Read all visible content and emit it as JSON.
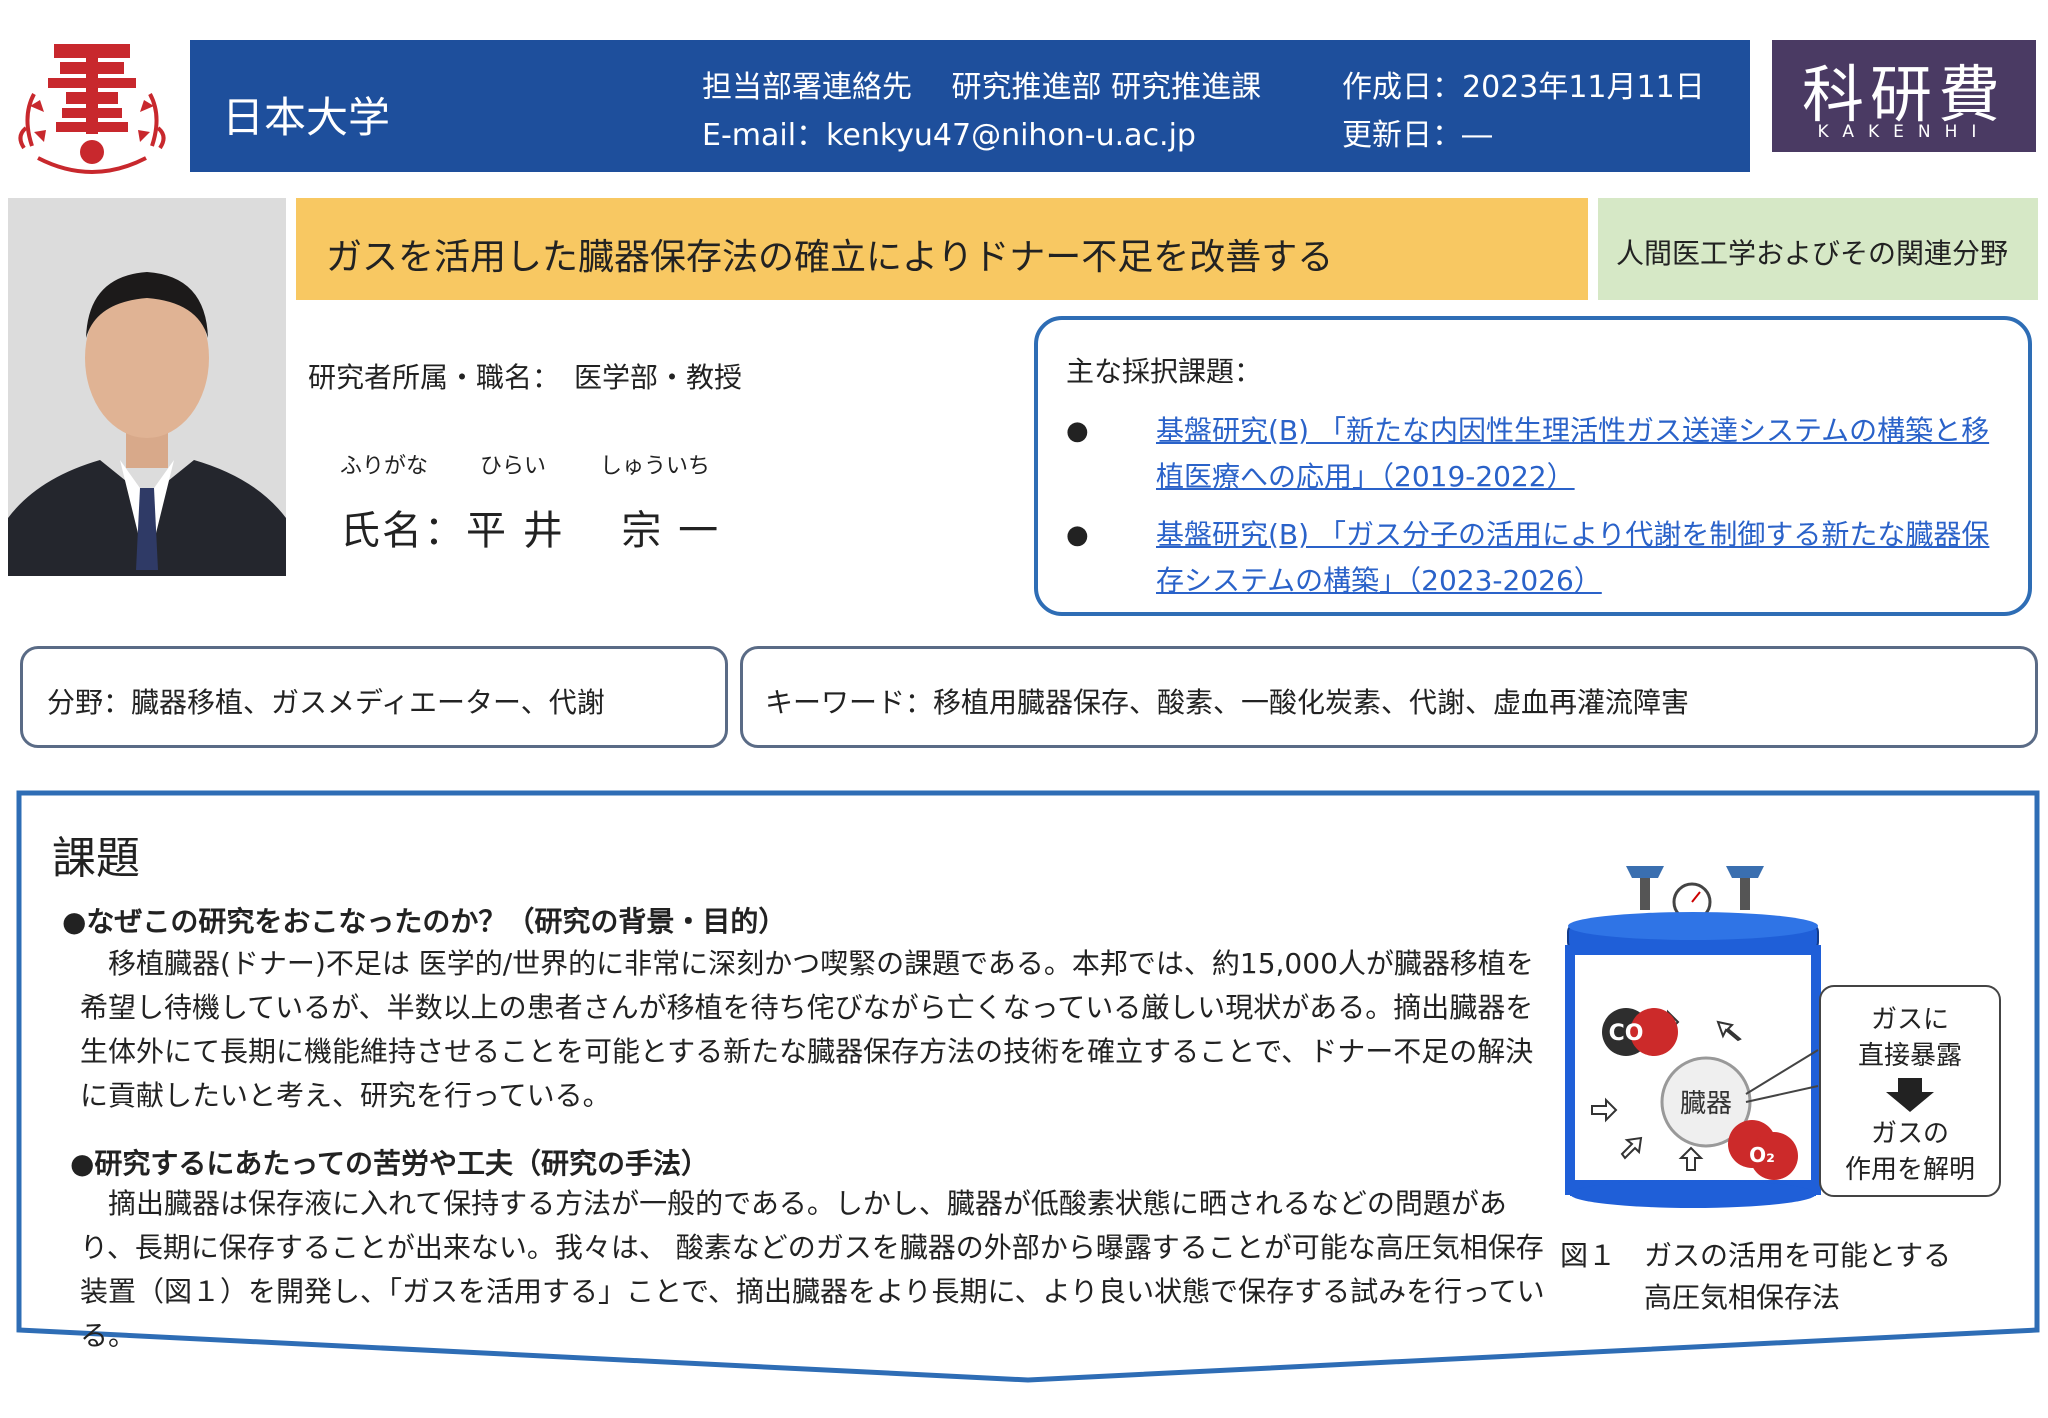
{
  "header": {
    "university": "日本大学",
    "contact_dept": "担当部署連絡先　 研究推進部 研究推進課",
    "contact_email": "E-mail：kenkyu47@nihon-u.ac.jp",
    "created": "作成日：2023年11月11日",
    "updated": "更新日：―",
    "kakenhi_main": "科研費",
    "kakenhi_sub": "KAKENHI"
  },
  "title": "ガスを活用した臓器保存法の確立によりドナー不足を改善する",
  "field": "人間医工学およびその関連分野",
  "researcher": {
    "affiliation": "研究者所属・職名：　医学部・教授",
    "furigana_label": "ふりがな",
    "furigana_last": "ひらい",
    "furigana_first": "しゅういち",
    "name": "氏名：平 井　 宗 一"
  },
  "grants": {
    "heading": "主な採択課題：",
    "bullet": "●",
    "items": [
      "基盤研究(B) 「新たな内因性生理活性ガス送達システムの構築と移植医療への応用」（2019-2022）",
      "基盤研究(B) 「ガス分子の活用により代謝を制御する新たな臓器保存システムの構築」（2023-2026）"
    ]
  },
  "bunya": "分野：臓器移植、ガスメディエーター、代謝",
  "keywords": "キーワード：移植用臓器保存、酸素、一酸化炭素、代謝、虚血再灌流障害",
  "kadai": {
    "title": "課題",
    "q1": "●なぜこの研究をおこなったのか？（研究の背景・目的）",
    "p1": "　移植臓器(ドナー)不足は 医学的/世界的に非常に深刻かつ喫緊の課題である。本邦では、約15,000人が臓器移植を希望し待機しているが、半数以上の患者さんが移植を待ち侘びながら亡くなっている厳しい現状がある。摘出臓器を生体外にて長期に機能維持させることを可能とする新たな臓器保存方法の技術を確立することで、ドナー不足の解決に貢献したいと考え、研究を行っている。",
    "q2": "●研究するにあたっての苦労や工夫（研究の手法）",
    "p2": "　摘出臓器は保存液に入れて保持する方法が一般的である。しかし、臓器が低酸素状態に晒されるなどの問題があり、長期に保存することが出来ない。我々は、 酸素などのガスを臓器の外部から曝露することが可能な高圧気相保存装置（図１）を開発し、「ガスを活用する」ことで、摘出臓器をより長期に、より良い状態で保存する試みを行っている。"
  },
  "figure": {
    "co_label": "CO",
    "o2_label": "O₂",
    "organ_label": "臓器",
    "callout_1": "ガスに",
    "callout_2": "直接暴露",
    "callout_3": "ガスの",
    "callout_4": "作用を解明",
    "caption_1": "図１　ガスの活用を可能とする",
    "caption_2": "高圧気相保存法"
  },
  "colors": {
    "header_blue": "#1e4f9c",
    "title_orange": "#f8c862",
    "field_green": "#d6e8c6",
    "kakenhi_purple": "#4a3a63",
    "link_blue": "#2a62c9",
    "logo_red": "#c8282d"
  }
}
